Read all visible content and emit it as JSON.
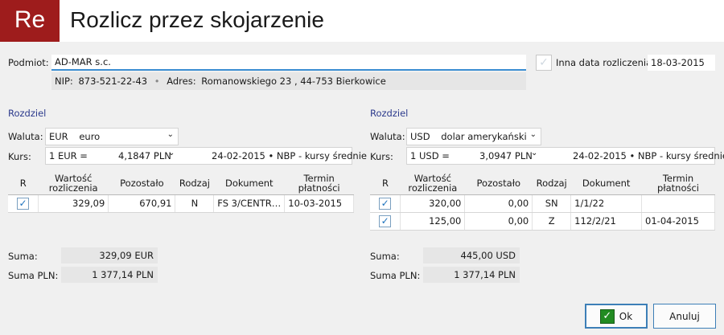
{
  "header": {
    "logo": "Re",
    "title": "Rozlicz przez skojarzenie"
  },
  "subject": {
    "label": "Podmiot:",
    "name": "AD-MAR s.c.",
    "nip_label": "NIP:",
    "nip": "873-521-22-43",
    "address_label": "Adres:",
    "address": "Romanowskiego 23 , 44-753 Bierkowice"
  },
  "other_date": {
    "label": "Inna data rozliczenia:",
    "value": "18-03-2015",
    "checked": false
  },
  "left": {
    "section_title": "Rozdziel",
    "currency_label": "Waluta:",
    "currency_code": "EUR",
    "currency_name": "euro",
    "rate_label": "Kurs:",
    "rate_unit": "1 EUR =",
    "rate_value": "4,1847 PLN",
    "rate_info": "24-02-2015 • NBP - kursy średnie",
    "columns": [
      "R",
      "Wartość rozliczenia",
      "Pozostało",
      "Rodzaj",
      "Dokument",
      "Termin płatności"
    ],
    "rows": [
      {
        "checked": true,
        "value": "329,09",
        "remaining": "670,91",
        "type": "N",
        "document": "FS 3/CENTR…",
        "due": "10-03-2015"
      }
    ],
    "sum_label": "Suma:",
    "sum_value": "329,09 EUR",
    "sum_pln_label": "Suma PLN:",
    "sum_pln_value": "1 377,14 PLN"
  },
  "right": {
    "section_title": "Rozdziel",
    "currency_label": "Waluta:",
    "currency_code": "USD",
    "currency_name": "dolar amerykański",
    "rate_label": "Kurs:",
    "rate_unit": "1 USD =",
    "rate_value": "3,0947 PLN",
    "rate_info": "24-02-2015 • NBP - kursy średnie",
    "columns": [
      "R",
      "Wartość rozliczenia",
      "Pozostało",
      "Rodzaj",
      "Dokument",
      "Termin płatności"
    ],
    "rows": [
      {
        "checked": true,
        "value": "320,00",
        "remaining": "0,00",
        "type": "SN",
        "document": "1/1/22",
        "due": ""
      },
      {
        "checked": true,
        "value": "125,00",
        "remaining": "0,00",
        "type": "Z",
        "document": "112/2/21",
        "due": "01-04-2015"
      }
    ],
    "sum_label": "Suma:",
    "sum_value": "445,00 USD",
    "sum_pln_label": "Suma PLN:",
    "sum_pln_value": "1 377,14 PLN"
  },
  "buttons": {
    "ok": "Ok",
    "cancel": "Anuluj"
  },
  "colors": {
    "logo_bg": "#9e1c1c",
    "accent": "#3c8ed2",
    "section_title": "#2c3a8c",
    "ok_icon": "#228b22"
  }
}
